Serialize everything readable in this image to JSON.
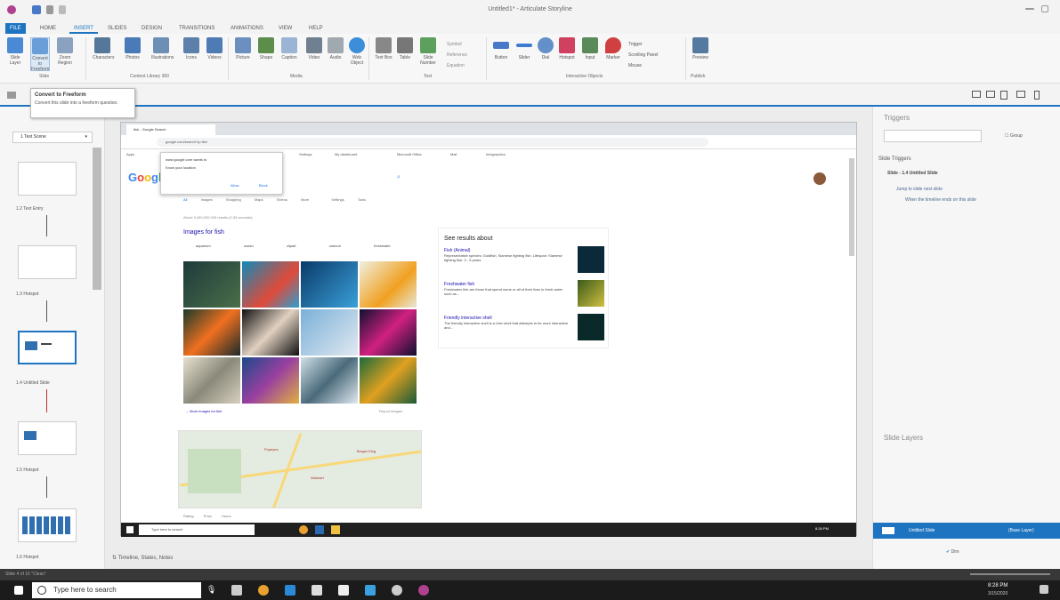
{
  "app": {
    "title": "Untitled1* - Articulate Storyline"
  },
  "ribbon_tabs": [
    "FILE",
    "HOME",
    "INSERT",
    "SLIDES",
    "DESIGN",
    "TRANSITIONS",
    "ANIMATIONS",
    "VIEW",
    "HELP"
  ],
  "ribbon_buttons": [
    {
      "label": "Slide Layer",
      "icon": "slide-layer-icon",
      "color": "#4a8ad4"
    },
    {
      "label": "Convert to Freeform",
      "icon": "convert-icon",
      "color": "#6a9ed8"
    },
    {
      "label": "Zoom Region",
      "icon": "zoom-icon",
      "color": "#8aa2c0"
    },
    {
      "label": "Characters",
      "icon": "character-icon",
      "color": "#557799"
    },
    {
      "label": "Photos",
      "icon": "photo-icon",
      "color": "#4a7ab8"
    },
    {
      "label": "Illustrations",
      "icon": "illustration-icon",
      "color": "#6e8fb5"
    },
    {
      "label": "Icons",
      "icon": "icons-icon",
      "color": "#5c80aa"
    },
    {
      "label": "Videos",
      "icon": "video-icon",
      "color": "#4e7bb3"
    },
    {
      "label": "Picture",
      "icon": "picture-icon",
      "color": "#6b8fbf"
    },
    {
      "label": "Shape",
      "icon": "shape-icon",
      "color": "#5d8d4b"
    },
    {
      "label": "Caption",
      "icon": "caption-icon",
      "color": "#9bb4d4"
    },
    {
      "label": "Video",
      "icon": "video2-icon",
      "color": "#708090"
    },
    {
      "label": "Audio",
      "icon": "audio-icon",
      "color": "#a0a8b0"
    },
    {
      "label": "Web Object",
      "icon": "web-icon",
      "color": "#3d8ed8"
    },
    {
      "label": "Text Box",
      "icon": "textbox-icon",
      "color": "#888"
    },
    {
      "label": "Table",
      "icon": "table-icon",
      "color": "#777"
    },
    {
      "label": "Slide Number",
      "icon": "slide-number-icon",
      "color": "#5da05d"
    },
    {
      "label": "Button",
      "icon": "button-icon",
      "color": "#4a78c8"
    },
    {
      "label": "Slider",
      "icon": "slider-icon",
      "color": "#3d7cd0"
    },
    {
      "label": "Dial",
      "icon": "dial-icon",
      "color": "#6390c8"
    },
    {
      "label": "Hotspot",
      "icon": "hotspot-icon",
      "color": "#d04060"
    },
    {
      "label": "Input",
      "icon": "input-icon",
      "color": "#5a8a5a"
    },
    {
      "label": "Marker",
      "icon": "marker-icon",
      "color": "#d04040"
    },
    {
      "label": "Preview",
      "icon": "preview-icon",
      "color": "#557aa0"
    }
  ],
  "ribbon_groups": [
    "Slide",
    "Content Library 360",
    "Media",
    "Text",
    "Interactive Objects",
    "Publish"
  ],
  "text_small_items": [
    "Symbol",
    "Reference",
    "Equation"
  ],
  "interactive_small_items": [
    "Trigger",
    "Scrolling Panel",
    "Mouse"
  ],
  "tooltip": {
    "title": "Convert to Freeform",
    "body": "Convert this slide into a freeform question."
  },
  "scene": {
    "selector": "1 Test Scene",
    "slides": [
      {
        "label": "1.2 Text Entry"
      },
      {
        "label": "1.3 Hotspot"
      },
      {
        "label": "1.4 Untitled Slide"
      },
      {
        "label": "1.5 Hotspot"
      },
      {
        "label": "1.6 Hotspot"
      }
    ]
  },
  "browser": {
    "tab": "fish - Google Search",
    "url": "google.com/search?q=fish",
    "popup": {
      "site": "www.google.com wants to",
      "line": "Know your location",
      "allow": "Allow",
      "block": "Block"
    },
    "bookmarks": [
      "Apps",
      "Settings",
      "My dashboard",
      "Microsoft Office",
      "Mail",
      "Infographics"
    ],
    "google_logo": [
      "G",
      "o",
      "o",
      "g",
      "l",
      "e"
    ],
    "logo_colors": [
      "#4285F4",
      "#EA4335",
      "#FBBC05",
      "#4285F4",
      "#34A853",
      "#EA4335"
    ],
    "search_tabs": [
      "All",
      "Images",
      "Shopping",
      "Maps",
      "Videos",
      "More",
      "Settings",
      "Tools"
    ],
    "result_stats": "About 3,450,000,000 results (0.53 seconds)",
    "images_title": "Images for fish",
    "chips": [
      "aquarium",
      "ocean",
      "clipart",
      "cartoon",
      "freshwater"
    ],
    "more_images": "More images for fish",
    "report_images": "Report images",
    "see_results_title": "See results about",
    "results": [
      {
        "title": "Fish (Animal)",
        "text": "Representative species: Goldfish, Siamese fighting fish. Lifespan: Siamese fighting fish: 3 - 5 years"
      },
      {
        "title": "Freshwater fish",
        "text": "Freshwater fish are those that spend some or all of their lives in fresh water such as..."
      },
      {
        "title": "Friendly interactive shell",
        "text": "The friendly interactive shell is a Unix shell that attempts to be more interactive and..."
      }
    ],
    "map_labels": [
      "Popeyes",
      "Burger King",
      "Walmart"
    ],
    "map_filters": [
      "Rating",
      "Price",
      "Hours"
    ]
  },
  "inner_taskbar": {
    "search": "Type here to search",
    "time": "8:28 PM"
  },
  "right": {
    "triggers_title": "Triggers",
    "group_label": "Group",
    "slide_triggers": "Slide Triggers",
    "slide_name": "Slide - 1.4 Untitled Slide",
    "trigger_line1": "Jump to slide next slide",
    "trigger_line2": "When the timeline ends on this slide",
    "layers_title": "Slide Layers",
    "layer_name": "Untitled Slide",
    "base_layer": "(Base Layer)",
    "dim_label": "Dim"
  },
  "timeline_bar": "Timeline, States, Notes",
  "status_left": "Slide 4 of 16   \"Clean\"",
  "taskbar": {
    "search": "Type here to search",
    "time": "8:28 PM",
    "date": "3/15/2020"
  }
}
